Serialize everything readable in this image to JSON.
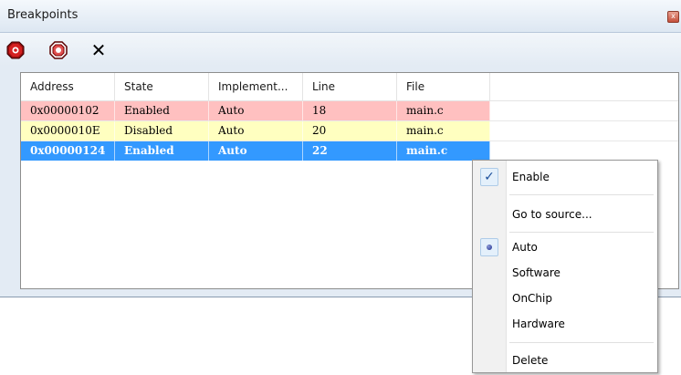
{
  "window": {
    "title": "Breakpoints",
    "close_glyph": "x"
  },
  "toolbar": {
    "enable_icon": "breakpoint-red-icon",
    "disable_icon": "breakpoint-hollow-icon",
    "delete_label": "✕"
  },
  "table": {
    "columns": [
      "Address",
      "State",
      "Implement...",
      "Line",
      "File"
    ],
    "rows": [
      {
        "address": "0x00000102",
        "state": "Enabled",
        "implementation": "Auto",
        "line": "18",
        "file": "main.c",
        "color": "#ffc0c0"
      },
      {
        "address": "0x0000010E",
        "state": "Disabled",
        "implementation": "Auto",
        "line": "20",
        "file": "main.c",
        "color": "#ffffc0"
      },
      {
        "address": "0x00000124",
        "state": "Enabled",
        "implementation": "Auto",
        "line": "22",
        "file": "main.c",
        "color": "#3399ff",
        "selected": true
      }
    ]
  },
  "context_menu": {
    "items": [
      {
        "label": "Enable",
        "checked": true
      },
      {
        "label": "Go to source..."
      },
      {
        "label": "Auto",
        "radio_selected": true
      },
      {
        "label": "Software"
      },
      {
        "label": "OnChip"
      },
      {
        "label": "Hardware"
      },
      {
        "label": "Delete"
      }
    ],
    "check_glyph": "✓"
  },
  "colors": {
    "selection": "#3399ff",
    "enabled_row": "#ffc0c0",
    "disabled_row": "#ffffc0"
  }
}
